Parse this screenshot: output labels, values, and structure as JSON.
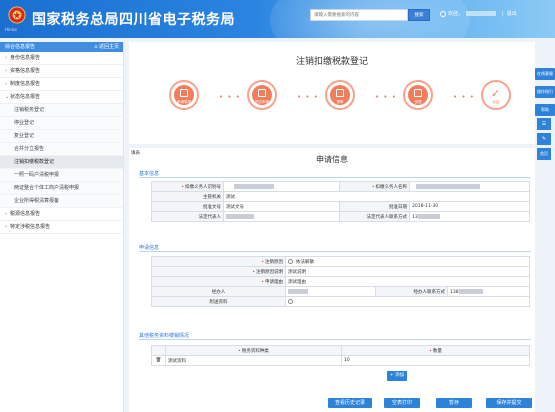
{
  "header": {
    "site_title": "国家税务总局四川省电子税务局",
    "logo_sub": "Hiniss",
    "search_placeholder": "请输入需要搜索的内容",
    "search_button": "搜索",
    "greeting": "欢迎，",
    "logout": "退出"
  },
  "sidebar": {
    "title": "综合信息报告",
    "back": "返回主页",
    "items": [
      {
        "label": "身份信息报告",
        "arrow": "›"
      },
      {
        "label": "资格信息报告",
        "arrow": "›"
      },
      {
        "label": "制度信息报告",
        "arrow": "›"
      },
      {
        "label": "状态信息报告",
        "arrow": "⌄"
      }
    ],
    "subitems": [
      {
        "label": "注销税务登记"
      },
      {
        "label": "停业登记"
      },
      {
        "label": "复业登记"
      },
      {
        "label": "合并分立报告"
      },
      {
        "label": "注销扣缴税款登记"
      },
      {
        "label": "一照一码户清税申报"
      },
      {
        "label": "两证整合个体工商户清税申报"
      },
      {
        "label": "企业所得税清算报备"
      }
    ],
    "items_after": [
      {
        "label": "税源信息报告",
        "arrow": "›"
      },
      {
        "label": "特定涉税信息报告",
        "arrow": "›"
      }
    ]
  },
  "steps": {
    "page_title": "注销扣缴税款登记",
    "items": [
      {
        "label": "申请填报"
      },
      {
        "label": "提交申报"
      },
      {
        "label": "预审"
      },
      {
        "label": "受理"
      },
      {
        "label": "办结"
      }
    ],
    "dots": "• • •"
  },
  "form": {
    "tag": "填表",
    "title": "申请信息",
    "basic": {
      "heading": "基本信息",
      "withholding_id_label": "扣缴义务人识别号",
      "withholding_name_label": "扣缴义务人名称",
      "tax_office_label": "主管机关",
      "tax_office_value": "测试",
      "approval_doc_label": "批准文号",
      "approval_doc_value": "测试文号",
      "approval_date_label": "批准日期",
      "approval_date_value": "2018-11-30",
      "legal_rep_label": "法定代表人",
      "legal_contact_label": "法定代表人联系方式",
      "legal_contact_value": "13"
    },
    "apply": {
      "heading": "申请信息",
      "cancel_reason_label": "注销原因",
      "cancel_reason_value": "依法解散",
      "cancel_desc_label": "注销原因说明",
      "cancel_desc_value": "测试说明",
      "apply_reason_label": "申请理由",
      "apply_reason_value": "测试理由",
      "handler_label": "经办人",
      "handler_contact_label": "经办人联系方式",
      "handler_contact_value": "138",
      "attachment_label": "附送资料"
    },
    "other": {
      "heading": "其他税务资料缴销情况",
      "col_type": "税务资料种类",
      "col_qty": "数量",
      "row_type": "测试资料",
      "row_qty": "10",
      "add_button": "+ 添加"
    }
  },
  "side": {
    "tabs": [
      {
        "label": "在线客服"
      },
      {
        "label": "操作指引"
      },
      {
        "label": "帮助"
      }
    ],
    "icons": [
      {
        "glyph": "☰"
      },
      {
        "glyph": "✎"
      },
      {
        "glyph": "首页"
      }
    ]
  },
  "bottom": {
    "history": "查看历史记录",
    "print": "空表打印",
    "save": "暂存",
    "submit": "保存并提交"
  }
}
